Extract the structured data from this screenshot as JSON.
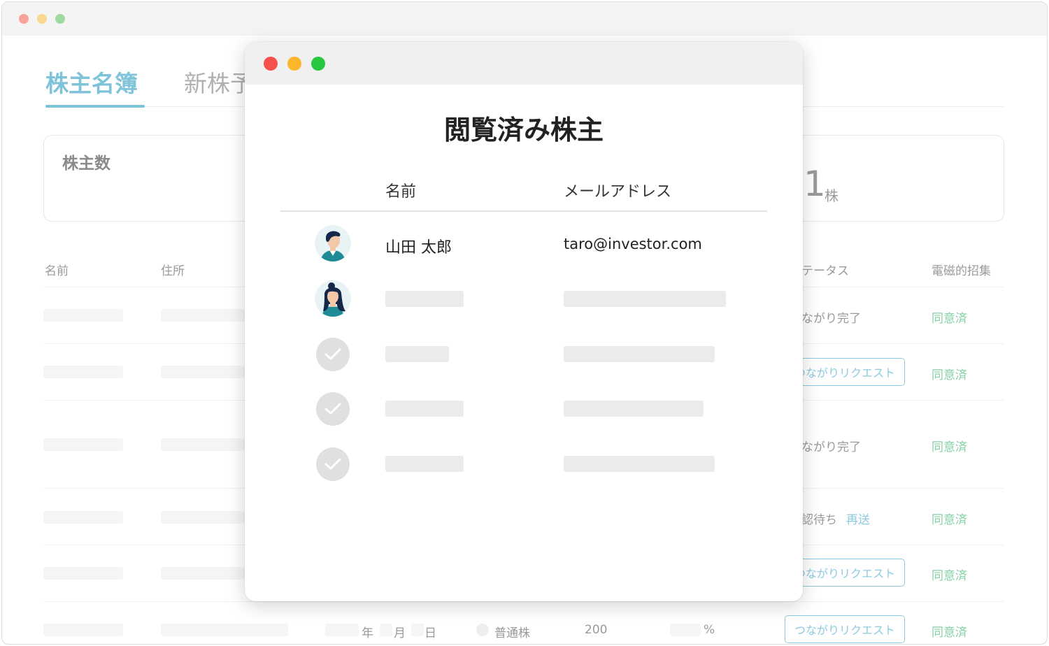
{
  "background": {
    "tabs": [
      {
        "label": "株主名簿",
        "active": true
      },
      {
        "label": "新株予",
        "active": false
      }
    ],
    "stats": {
      "label": "株主数",
      "value": "1",
      "unit": "株"
    },
    "columns": {
      "name": "名前",
      "address": "住所",
      "status": "テータス",
      "consent": "電磁的招集"
    },
    "rows": [
      {
        "status": "ながり完了",
        "consent": "同意済"
      },
      {
        "status_button": "つながりリクエスト",
        "consent": "同意済"
      },
      {
        "status": "ながり完了",
        "consent": "同意済"
      },
      {
        "status": "認待ち",
        "resend": "再送",
        "consent": "同意済"
      },
      {
        "status_button": "つながりリクエスト",
        "consent": "同意済"
      },
      {
        "status_button": "つながりリクエスト",
        "consent": "同意済"
      }
    ],
    "bottom_row": {
      "year": "年",
      "month": "月",
      "day": "日",
      "share_type": "普通株",
      "shares": "200",
      "percent": "%"
    }
  },
  "modal": {
    "title": "閲覧済み株主",
    "columns": {
      "name": "名前",
      "email": "メールアドレス"
    },
    "rows": [
      {
        "name": "山田 太郎",
        "email": "taro@investor.com",
        "icon": "male-avatar-icon"
      },
      {
        "icon": "female-avatar-icon"
      },
      {
        "icon": "check-icon"
      },
      {
        "icon": "check-icon"
      },
      {
        "icon": "check-icon"
      }
    ]
  },
  "colors": {
    "accent_blue": "#7fc3d9",
    "consent_green": "#86d0a6",
    "close": "#f5514c",
    "minimize": "#fbb62c",
    "maximize": "#26c840"
  }
}
